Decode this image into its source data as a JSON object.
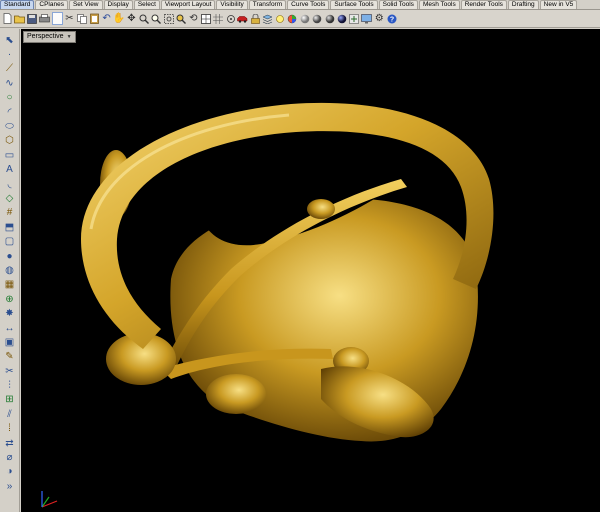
{
  "tabs": [
    {
      "label": "Standard",
      "active": true
    },
    {
      "label": "CPlanes"
    },
    {
      "label": "Set View"
    },
    {
      "label": "Display"
    },
    {
      "label": "Select"
    },
    {
      "label": "Viewport Layout"
    },
    {
      "label": "Visibility"
    },
    {
      "label": "Transform"
    },
    {
      "label": "Curve Tools"
    },
    {
      "label": "Surface Tools"
    },
    {
      "label": "Solid Tools"
    },
    {
      "label": "Mesh Tools"
    },
    {
      "label": "Render Tools"
    },
    {
      "label": "Drafting"
    },
    {
      "label": "New in V5"
    }
  ],
  "viewport": {
    "label": "Perspective",
    "background": "#000000",
    "model_color": "#d4a52a"
  },
  "toolbar_icons": [
    "new-icon",
    "open-icon",
    "save-icon",
    "print-icon",
    "selected-square-icon",
    "cut-icon",
    "copy-icon",
    "paste-icon",
    "undo-icon",
    "pan-icon",
    "move-icon",
    "zoom-icon",
    "zoom-window-icon",
    "zoom-extents-icon",
    "zoom-selected-icon",
    "rotate-view-icon",
    "four-viewports-icon",
    "grid-icon",
    "osnap-icon",
    "car-icon",
    "lock-icon",
    "layer-icon",
    "light-icon",
    "color-circle-icon",
    "material-sphere-icon",
    "render-sphere-icon",
    "shaded-sphere-icon",
    "dark-sphere-icon",
    "options-icon",
    "monitor-icon",
    "gear-icon",
    "help-icon"
  ],
  "left_icons": [
    "select-arrow-icon",
    "point-icon",
    "polyline-icon",
    "curve-icon",
    "circle-icon",
    "arc-icon",
    "ellipse-icon",
    "polygon-icon",
    "rectangle-icon",
    "text-icon",
    "fillet-icon",
    "surface-icon",
    "network-icon",
    "extrude-icon",
    "box-icon",
    "sphere-icon",
    "cylinder-icon",
    "mesh-icon",
    "boolean-icon",
    "explode-icon",
    "dimension-icon",
    "block-icon",
    "annotation-icon",
    "trim-icon",
    "split-icon",
    "join-icon",
    "offset-icon",
    "array-icon",
    "transform-icon",
    "analyze-icon",
    "render-icon",
    "more-icon"
  ]
}
